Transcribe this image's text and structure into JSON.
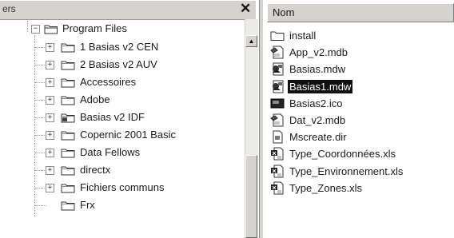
{
  "left_panel": {
    "title": "ers",
    "close_glyph": "✕"
  },
  "tree": {
    "root": {
      "label": "Program Files",
      "expander": "−"
    },
    "children": [
      {
        "label": "1 Basias v2 CEN",
        "expander": "+"
      },
      {
        "label": "2 Basias v2 AUV",
        "expander": "+"
      },
      {
        "label": "Accessoires",
        "expander": "+"
      },
      {
        "label": "Adobe",
        "expander": "+"
      },
      {
        "label": "Basias v2 IDF",
        "expander": "+"
      },
      {
        "label": "Copernic 2001 Basic",
        "expander": "+"
      },
      {
        "label": "Data Fellows",
        "expander": "+"
      },
      {
        "label": "directx",
        "expander": "+"
      },
      {
        "label": "Fichiers communs",
        "expander": "+"
      },
      {
        "label": "Frx",
        "expander": ""
      }
    ]
  },
  "scrollbar": {
    "up_glyph": "▲"
  },
  "right_panel": {
    "column_header": "Nom",
    "files": [
      {
        "label": "install",
        "icon": "folder-icon",
        "selected": false
      },
      {
        "label": "App_v2.mdb",
        "icon": "access-database-icon",
        "selected": false
      },
      {
        "label": "Basias.mdw",
        "icon": "workgroup-file-icon",
        "selected": false
      },
      {
        "label": "Basias1.mdw",
        "icon": "workgroup-file-icon",
        "selected": true
      },
      {
        "label": "Basias2.ico",
        "icon": "icon-file-icon",
        "selected": false
      },
      {
        "label": "Dat_v2.mdb",
        "icon": "access-database-icon",
        "selected": false
      },
      {
        "label": "Mscreate.dir",
        "icon": "generic-file-icon",
        "selected": false
      },
      {
        "label": "Type_Coordonnées.xls",
        "icon": "excel-file-icon",
        "selected": false
      },
      {
        "label": "Type_Environnement.xls",
        "icon": "excel-file-icon",
        "selected": false
      },
      {
        "label": "Type_Zones.xls",
        "icon": "excel-file-icon",
        "selected": false
      }
    ]
  },
  "colors": {
    "chrome": "#d6d3ce",
    "selection": "#101010"
  }
}
